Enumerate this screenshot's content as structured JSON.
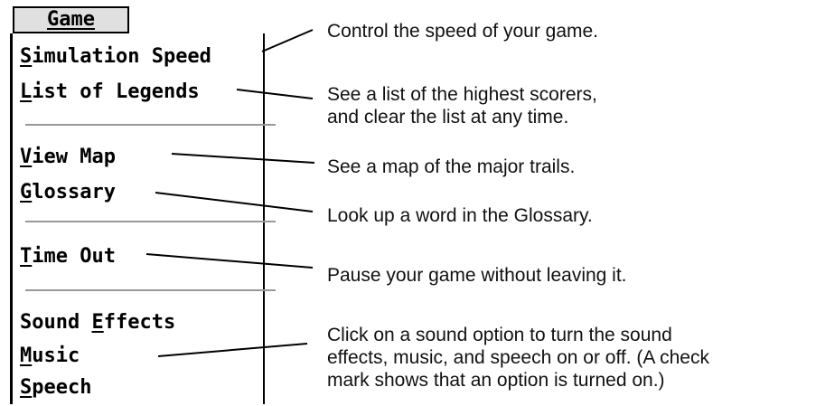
{
  "menu": {
    "title": "Game",
    "items": [
      {
        "pre": "",
        "key": "S",
        "post": "imulation Speed"
      },
      {
        "pre": "",
        "key": "L",
        "post": "ist of Legends"
      },
      {
        "pre": "",
        "key": "V",
        "post": "iew Map"
      },
      {
        "pre": "",
        "key": "G",
        "post": "lossary"
      },
      {
        "pre": "",
        "key": "T",
        "post": "ime Out"
      },
      {
        "pre": "Sound ",
        "key": "E",
        "post": "ffects"
      },
      {
        "pre": "",
        "key": "M",
        "post": "usic"
      },
      {
        "pre": "",
        "key": "S",
        "post": "peech"
      }
    ]
  },
  "callouts": [
    {
      "lines": [
        "Control the speed of your game."
      ]
    },
    {
      "lines": [
        "See a list of the highest scorers,",
        "and clear the list at any time."
      ]
    },
    {
      "lines": [
        "See a map of the major trails."
      ]
    },
    {
      "lines": [
        "Look up a word in the Glossary."
      ]
    },
    {
      "lines": [
        "Pause your game without leaving it."
      ]
    },
    {
      "lines": [
        "Click on a sound option to turn the sound",
        "effects, music, and speech on or off. (A check",
        "mark shows that an option is turned on.)"
      ]
    }
  ]
}
